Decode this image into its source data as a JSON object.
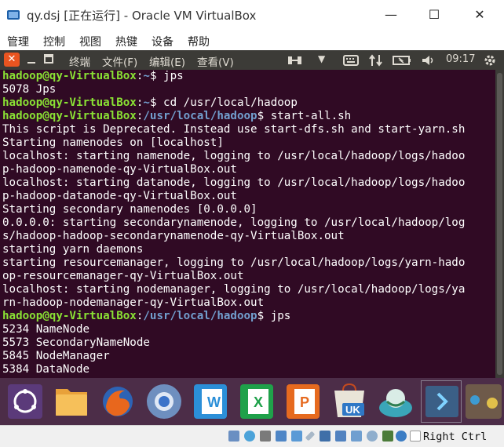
{
  "host": {
    "title": "qy.dsj [正在运行] - Oracle VM VirtualBox",
    "menu": [
      "管理",
      "控制",
      "视图",
      "热键",
      "设备",
      "帮助"
    ],
    "window_buttons": {
      "minimize": "—",
      "maximize": "☐",
      "close": "✕"
    }
  },
  "guest_panel": {
    "close_glyph": "✕",
    "menu": [
      "终端",
      "文件(F)",
      "编辑(E)",
      "查看(V)"
    ],
    "arrow": "▼",
    "clock": "09:17",
    "indicators": [
      "network-switch-icon",
      "keyboard-icon",
      "sort-arrows-icon",
      "battery-icon",
      "volume-icon",
      "gear-icon"
    ]
  },
  "terminal": {
    "colors": {
      "background": "#300a24",
      "user": "#8ae234",
      "path": "#729fcf",
      "text": "#ffffff"
    },
    "lines": [
      {
        "type": "prompt",
        "user": "hadoop@qy-VirtualBox",
        "path": "~",
        "cmd": " jps"
      },
      {
        "type": "out",
        "text": "5078 Jps"
      },
      {
        "type": "prompt",
        "user": "hadoop@qy-VirtualBox",
        "path": "~",
        "cmd": " cd /usr/local/hadoop"
      },
      {
        "type": "prompt",
        "user": "hadoop@qy-VirtualBox",
        "path": "/usr/local/hadoop",
        "cmd": " start-all.sh"
      },
      {
        "type": "out",
        "text": "This script is Deprecated. Instead use start-dfs.sh and start-yarn.sh"
      },
      {
        "type": "out",
        "text": "Starting namenodes on [localhost]"
      },
      {
        "type": "out",
        "text": "localhost: starting namenode, logging to /usr/local/hadoop/logs/hadoo"
      },
      {
        "type": "out",
        "text": "p-hadoop-namenode-qy-VirtualBox.out"
      },
      {
        "type": "out",
        "text": "localhost: starting datanode, logging to /usr/local/hadoop/logs/hadoo"
      },
      {
        "type": "out",
        "text": "p-hadoop-datanode-qy-VirtualBox.out"
      },
      {
        "type": "out",
        "text": "Starting secondary namenodes [0.0.0.0]"
      },
      {
        "type": "out",
        "text": "0.0.0.0: starting secondarynamenode, logging to /usr/local/hadoop/log"
      },
      {
        "type": "out",
        "text": "s/hadoop-hadoop-secondarynamenode-qy-VirtualBox.out"
      },
      {
        "type": "out",
        "text": "starting yarn daemons"
      },
      {
        "type": "out",
        "text": "starting resourcemanager, logging to /usr/local/hadoop/logs/yarn-hado"
      },
      {
        "type": "out",
        "text": "op-resourcemanager-qy-VirtualBox.out"
      },
      {
        "type": "out",
        "text": "localhost: starting nodemanager, logging to /usr/local/hadoop/logs/ya"
      },
      {
        "type": "out",
        "text": "rn-hadoop-nodemanager-qy-VirtualBox.out"
      },
      {
        "type": "prompt",
        "user": "hadoop@qy-VirtualBox",
        "path": "/usr/local/hadoop",
        "cmd": " jps"
      },
      {
        "type": "out",
        "text": "5234 NameNode"
      },
      {
        "type": "out",
        "text": "5573 SecondaryNameNode"
      },
      {
        "type": "out",
        "text": "5845 NodeManager"
      },
      {
        "type": "out",
        "text": "5384 DataNode"
      }
    ]
  },
  "dock": {
    "items": [
      {
        "name": "dash-icon"
      },
      {
        "name": "files-icon"
      },
      {
        "name": "firefox-icon"
      },
      {
        "name": "chromium-icon"
      },
      {
        "name": "libreoffice-writer-icon",
        "label": "W"
      },
      {
        "name": "libreoffice-calc-icon",
        "label": "X"
      },
      {
        "name": "libreoffice-impress-icon",
        "label": "P"
      },
      {
        "name": "ubuntu-software-icon",
        "label": "UK"
      },
      {
        "name": "amazon-icon"
      },
      {
        "name": "terminal-icon"
      }
    ]
  },
  "statusbar": {
    "icons": [
      "hard-disk-icon",
      "optical-drive-icon",
      "audio-icon",
      "network-icon",
      "usb-icon",
      "shared-folders-icon",
      "display-icon",
      "video-capture-icon",
      "cpu-icon",
      "mouse-integration-icon",
      "arrow-down-icon"
    ],
    "host_key": "Right Ctrl"
  }
}
